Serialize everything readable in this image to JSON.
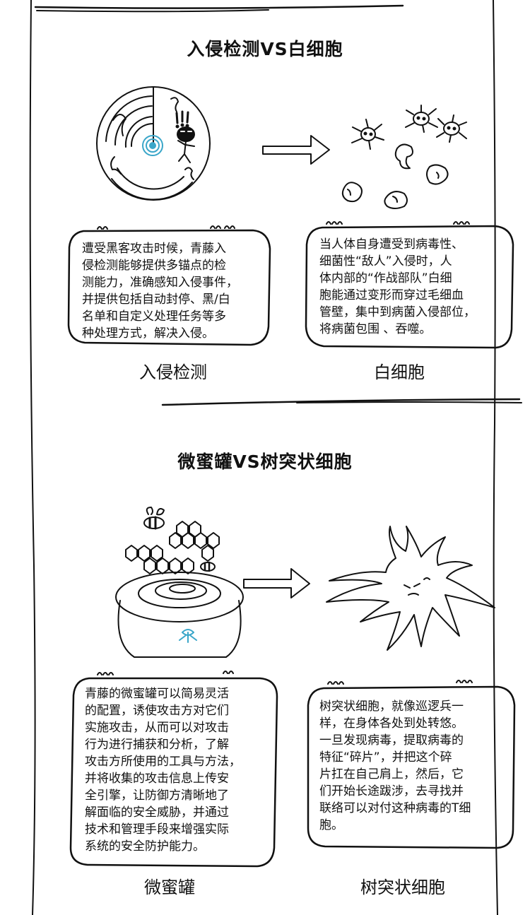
{
  "sections": [
    {
      "title": "入侵检测VS白细胞",
      "left": {
        "caption": "入侵检测",
        "lines": [
          "遭受黑客攻击时候，青藤入",
          "侵检测能够提供多锚点的检",
          "测能力，准确感知入侵事件，",
          "并提供包括自动封停、黑/白",
          "名单和自定义处理任务等多",
          "种处理方式，解决入侵。"
        ]
      },
      "right": {
        "caption": "白细胞",
        "lines": [
          "当人体自身遭受到病毒性、",
          "细菌性“敌人”入侵时，人",
          "体内部的“作战部队”白细",
          "胞能通过变形而穿过毛细血",
          "管壁，集中到病菌入侵部位，",
          "将病菌包围 、吞噬。"
        ]
      },
      "icon_emblem": "shield-eye-icon",
      "icon_alert": "!!!"
    },
    {
      "title": "微蜜罐VS树突状细胞",
      "left": {
        "caption": "微蜜罐",
        "lines": [
          "青藤的微蜜罐可以简易灵活",
          "的配置，诱使攻击方对它们",
          "实施攻击，从而可以对攻击",
          "行为进行捕获和分析，了解",
          "攻击方所使用的工具与方法，",
          "并将收集的攻击信息上传安",
          "全引擎，让防御方清晰地了",
          "解面临的安全威胁，并通过",
          "技术和管理手段来增强实际",
          "系统的安全防护能力。"
        ]
      },
      "right": {
        "caption": "树突状细胞",
        "lines": [
          "树突状细胞，就像巡逻兵一",
          "样，在身体各处到处转悠。",
          "一旦发现病毒，提取病毒的",
          "特征“碎片”，并把这个碎",
          "片扛在自己肩上，然后，它",
          "们开始长途跋涉，去寻找并",
          "联络可以对付这种病毒的T细",
          "胞。"
        ]
      }
    }
  ],
  "colors": {
    "ink": "#111111",
    "accent": "#3aa6c9",
    "paper": "#ffffff"
  }
}
